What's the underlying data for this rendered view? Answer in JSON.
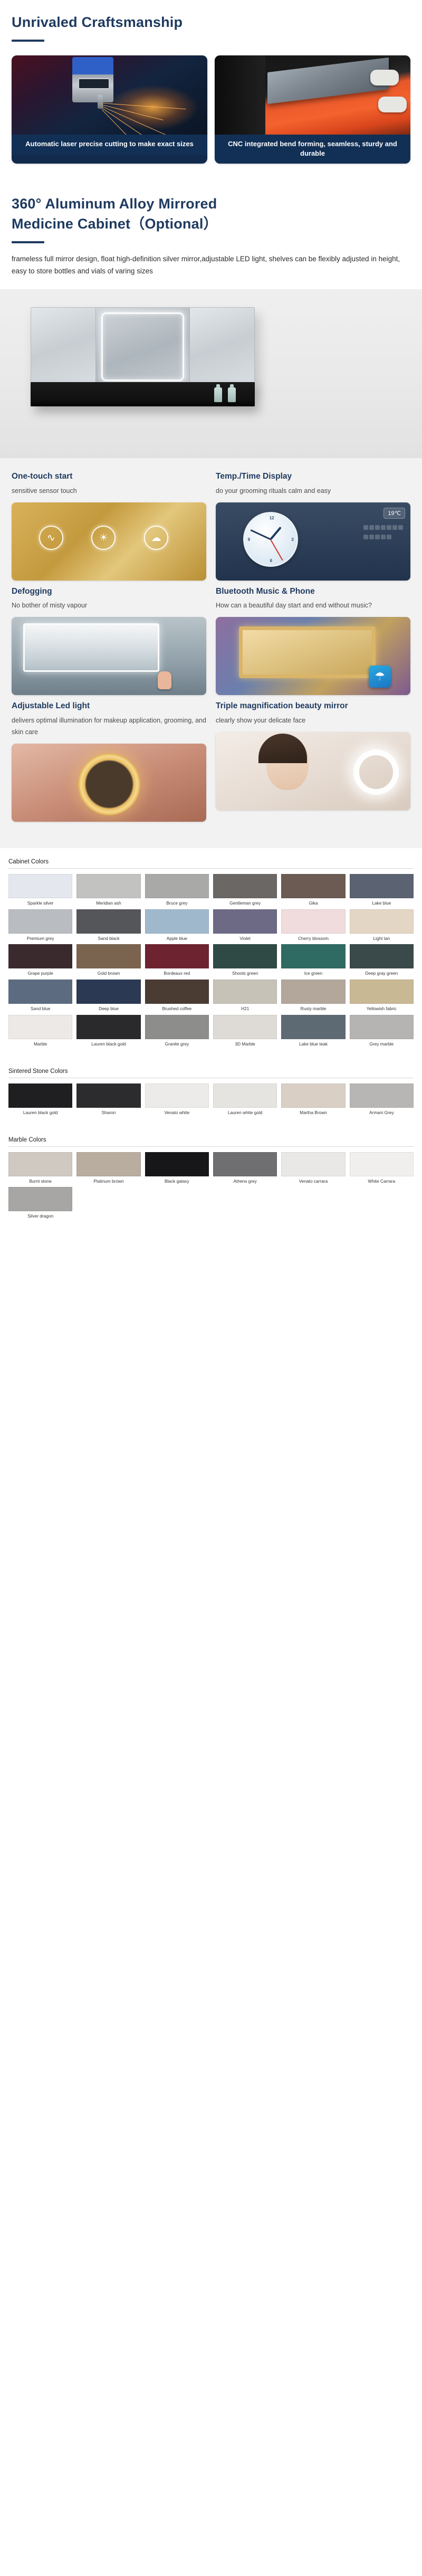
{
  "craft": {
    "title": "Unrivaled Craftsmanship",
    "cards": [
      {
        "caption": "Automatic laser precise cutting to make exact sizes",
        "image_name": "laser-cutting-photo"
      },
      {
        "caption": "CNC integrated bend forming, seamless, sturdy and durable",
        "image_name": "cnc-bending-photo"
      }
    ]
  },
  "cabinet": {
    "title_line1": "360° Aluminum Alloy Mirrored",
    "title_line2": "Medicine Cabinet（Optional）",
    "description": "frameless full mirror design, float high-definition silver mirror,adjustable LED light, shelves can be flexibly adjusted in height, easy to store  bottles and vials of varing sizes",
    "hero_image_name": "mirrored-medicine-cabinet-photo"
  },
  "features": [
    {
      "heading": "One-touch start",
      "sub": "sensitive sensor touch",
      "image_name": "touch-sensor-panel-photo",
      "icons": [
        "defog-icon",
        "brightness-icon",
        "bluetooth-icon"
      ]
    },
    {
      "heading": "Temp./Time Display",
      "sub": "do your grooming rituals calm and easy",
      "image_name": "clock-temperature-display-photo",
      "temperature": "19℃",
      "clock_numbers": [
        "12",
        "3",
        "6",
        "9"
      ]
    },
    {
      "heading": "Defogging",
      "sub": "No bother of misty vapour",
      "image_name": "defogging-mirror-photo"
    },
    {
      "heading": "Bluetooth Music & Phone",
      "sub": "How can a beautiful day start and end without music?",
      "image_name": "bluetooth-music-photo",
      "badge_icon": "bluetooth-icon"
    },
    {
      "heading": "Adjustable Led light",
      "sub": "delivers optimal illumination for makeup application, grooming, and skin care",
      "image_name": "adjustable-led-light-photo"
    },
    {
      "heading": "Triple magnification beauty mirror",
      "sub": "clearly show your delicate face",
      "image_name": "beauty-magnifying-mirror-photo"
    }
  ],
  "color_sections": [
    {
      "title": "Cabinet Colors",
      "swatches": [
        {
          "label": "Sparkle silver",
          "color": "#e4e8ee"
        },
        {
          "label": "Meridian ash",
          "color": "#c2c2c0"
        },
        {
          "label": "Bruce grey",
          "color": "#a9a9a7"
        },
        {
          "label": "Gentleman grey",
          "color": "#6a6765"
        },
        {
          "label": "Gika",
          "color": "#6b5b52"
        },
        {
          "label": "Lake blue",
          "color": "#5b6272"
        },
        {
          "label": "Premium grey",
          "color": "#b9bcc0"
        },
        {
          "label": "Sand black",
          "color": "#55565a"
        },
        {
          "label": "Apple blue",
          "color": "#9fb8cc"
        },
        {
          "label": "Violet",
          "color": "#6d6a86"
        },
        {
          "label": "Cherry blossom",
          "color": "#f0dcdc"
        },
        {
          "label": "Light tan",
          "color": "#e4d6c4"
        },
        {
          "label": "Grape purple",
          "color": "#3a2a2e"
        },
        {
          "label": "Gold brown",
          "color": "#7a6450"
        },
        {
          "label": "Bordeaux red",
          "color": "#6e2430"
        },
        {
          "label": "Shoots green",
          "color": "#2f4a45"
        },
        {
          "label": "Ice green",
          "color": "#2f6b63"
        },
        {
          "label": "Deep gray green",
          "color": "#3a4a4a"
        },
        {
          "label": "Sand blue",
          "color": "#5c6b80"
        },
        {
          "label": "Deep blue",
          "color": "#2b3a52"
        },
        {
          "label": "Brushed coffee",
          "color": "#4a3b33"
        },
        {
          "label": "H21",
          "color": "#c6c2b8"
        },
        {
          "label": "Rusty marble",
          "color": "#b3a79c"
        },
        {
          "label": "Yellowish fabric",
          "color": "#c9b894"
        },
        {
          "label": "Marble",
          "color": "#ece9e6"
        },
        {
          "label": "Lauren black gold",
          "color": "#2a2a2c"
        },
        {
          "label": "Granite grey",
          "color": "#8d8d8b"
        },
        {
          "label": "3D Marble",
          "color": "#dedad6"
        },
        {
          "label": "Lake blue teak",
          "color": "#5d6a74"
        },
        {
          "label": "Grey marble",
          "color": "#b6b4b2"
        }
      ]
    },
    {
      "title": "Sintered Stone Colors",
      "swatches": [
        {
          "label": "Lauren black gold",
          "color": "#1f1f21"
        },
        {
          "label": "Sharon",
          "color": "#2c2c2e"
        },
        {
          "label": "Venato white",
          "color": "#ecebe9"
        },
        {
          "label": "Lauren white gold",
          "color": "#e6e4e0"
        },
        {
          "label": "Martha Brown",
          "color": "#d9cfc4"
        },
        {
          "label": "Armani Grey",
          "color": "#b8b6b4"
        }
      ]
    },
    {
      "title": "Marble Colors",
      "swatches": [
        {
          "label": "Burnt stone",
          "color": "#cfc9c2"
        },
        {
          "label": "Platinum brown",
          "color": "#b9ada0"
        },
        {
          "label": "Black galaxy",
          "color": "#171719"
        },
        {
          "label": "Athens grey",
          "color": "#6f6f71"
        },
        {
          "label": "Venato carrara",
          "color": "#e9e8e6"
        },
        {
          "label": "White Carrara",
          "color": "#f0efee"
        },
        {
          "label": "Silver dragon",
          "color": "#a8a6a4"
        }
      ]
    }
  ],
  "theme": {
    "brand_navy": "#1e3a5f",
    "caption_bar": "#123055",
    "feature_bg": "#f2f2f2"
  }
}
